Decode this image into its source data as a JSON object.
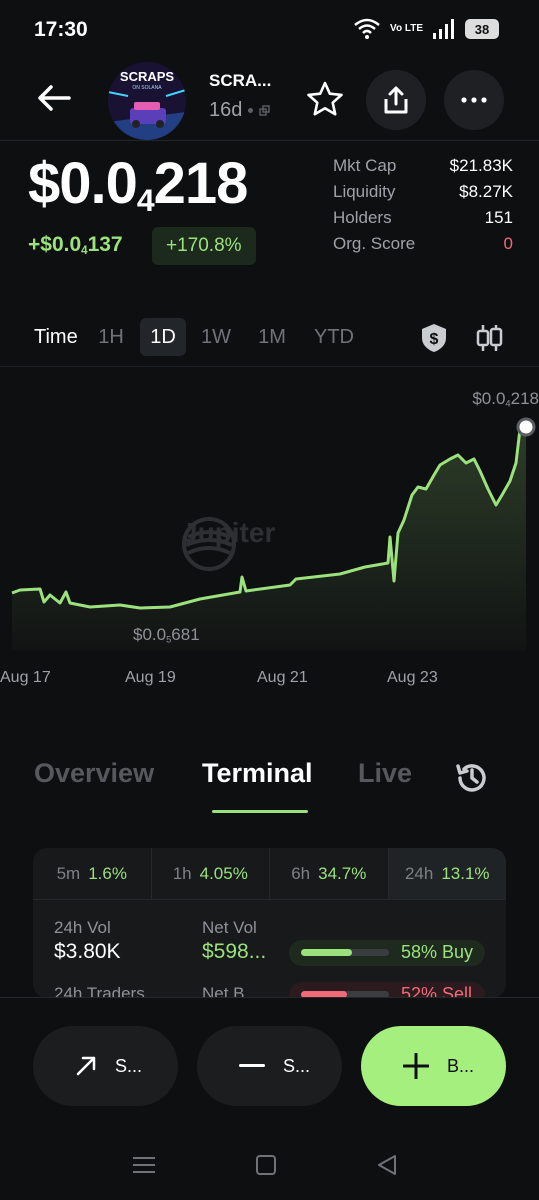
{
  "status": {
    "time": "17:30",
    "network": "Vo LTE",
    "battery": "38"
  },
  "header": {
    "token_name": "SCRA...",
    "age": "16d",
    "avatar_text": "SCRAPS",
    "avatar_subtext": "ON SOLANA"
  },
  "price": {
    "prefix": "$0.0",
    "zeros": "4",
    "digits": "218",
    "change_prefix": "+$0.0",
    "change_zeros": "4",
    "change_digits": "137",
    "change_pct": "+170.8%"
  },
  "stats": [
    {
      "label": "Mkt Cap",
      "value": "$21.83K"
    },
    {
      "label": "Liquidity",
      "value": "$8.27K"
    },
    {
      "label": "Holders",
      "value": "151"
    },
    {
      "label": "Org. Score",
      "value": "0"
    }
  ],
  "ranges": {
    "label": "Time",
    "items": [
      "1H",
      "1D",
      "1W",
      "1M",
      "YTD"
    ],
    "active": "1D"
  },
  "chart": {
    "watermark": "Jupiter",
    "max_prefix": "$0.0",
    "max_zeros": "4",
    "max_digits": "218",
    "min_prefix": "$0.0",
    "min_zeros": "5",
    "min_digits": "681",
    "x_labels": [
      "Aug 17",
      "Aug 19",
      "Aug 21",
      "Aug 23"
    ],
    "line_color": "#9be27c"
  },
  "tabs": {
    "items": [
      "Overview",
      "Terminal",
      "Live"
    ],
    "active": "Terminal"
  },
  "terminal": {
    "intervals": [
      {
        "label": "5m",
        "value": "1.6%"
      },
      {
        "label": "1h",
        "value": "4.05%"
      },
      {
        "label": "6h",
        "value": "34.7%"
      },
      {
        "label": "24h",
        "value": "13.1%"
      }
    ],
    "vol_label": "24h Vol",
    "vol_value": "$3.80K",
    "net_vol_label": "Net Vol",
    "net_vol_value": "$598...",
    "buy_text": "58% Buy",
    "buy_pct": 58,
    "traders_label": "24h Traders",
    "net_b_label": "Net B",
    "sell_text": "52% Sell",
    "sell_pct": 52
  },
  "actions": {
    "sell": "S...",
    "swap": "S...",
    "buy": "B..."
  },
  "colors": {
    "accent": "#9be27c",
    "negative": "#f26a78",
    "buy_button": "#a5ef7f"
  }
}
